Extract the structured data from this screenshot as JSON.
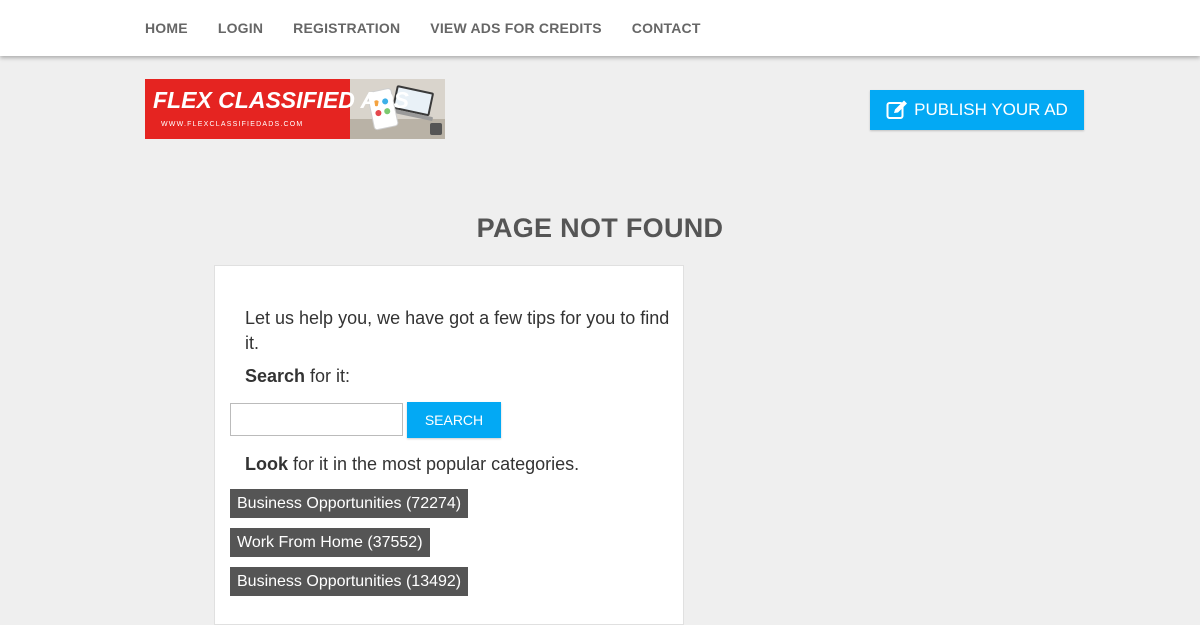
{
  "nav": {
    "items": [
      {
        "label": "HOME"
      },
      {
        "label": "LOGIN"
      },
      {
        "label": "REGISTRATION"
      },
      {
        "label": "VIEW ADS FOR CREDITS"
      },
      {
        "label": "CONTACT"
      }
    ]
  },
  "logo": {
    "title": "FLEX CLASSIFIED ADS",
    "url": "WWW.FLEXCLASSIFIEDADS.COM"
  },
  "header": {
    "publish_label": "PUBLISH YOUR AD",
    "publish_icon": "edit-icon"
  },
  "page": {
    "title": "PAGE NOT FOUND"
  },
  "help": {
    "tips": "Let us help you, we have got a few tips for you to find it.",
    "search_bold": "Search",
    "search_rest": " for it:",
    "search_value": "",
    "search_button": "SEARCH",
    "look_bold": "Look",
    "look_rest": " for it in the most popular categories.",
    "categories": [
      {
        "label": "Business Opportunities (72274)"
      },
      {
        "label": "Work From Home (37552)"
      },
      {
        "label": "Business Opportunities (13492)"
      }
    ]
  },
  "colors": {
    "accent": "#03a9f4",
    "logo_red": "#e52421",
    "category_bg": "#555555",
    "background": "#efefef"
  }
}
